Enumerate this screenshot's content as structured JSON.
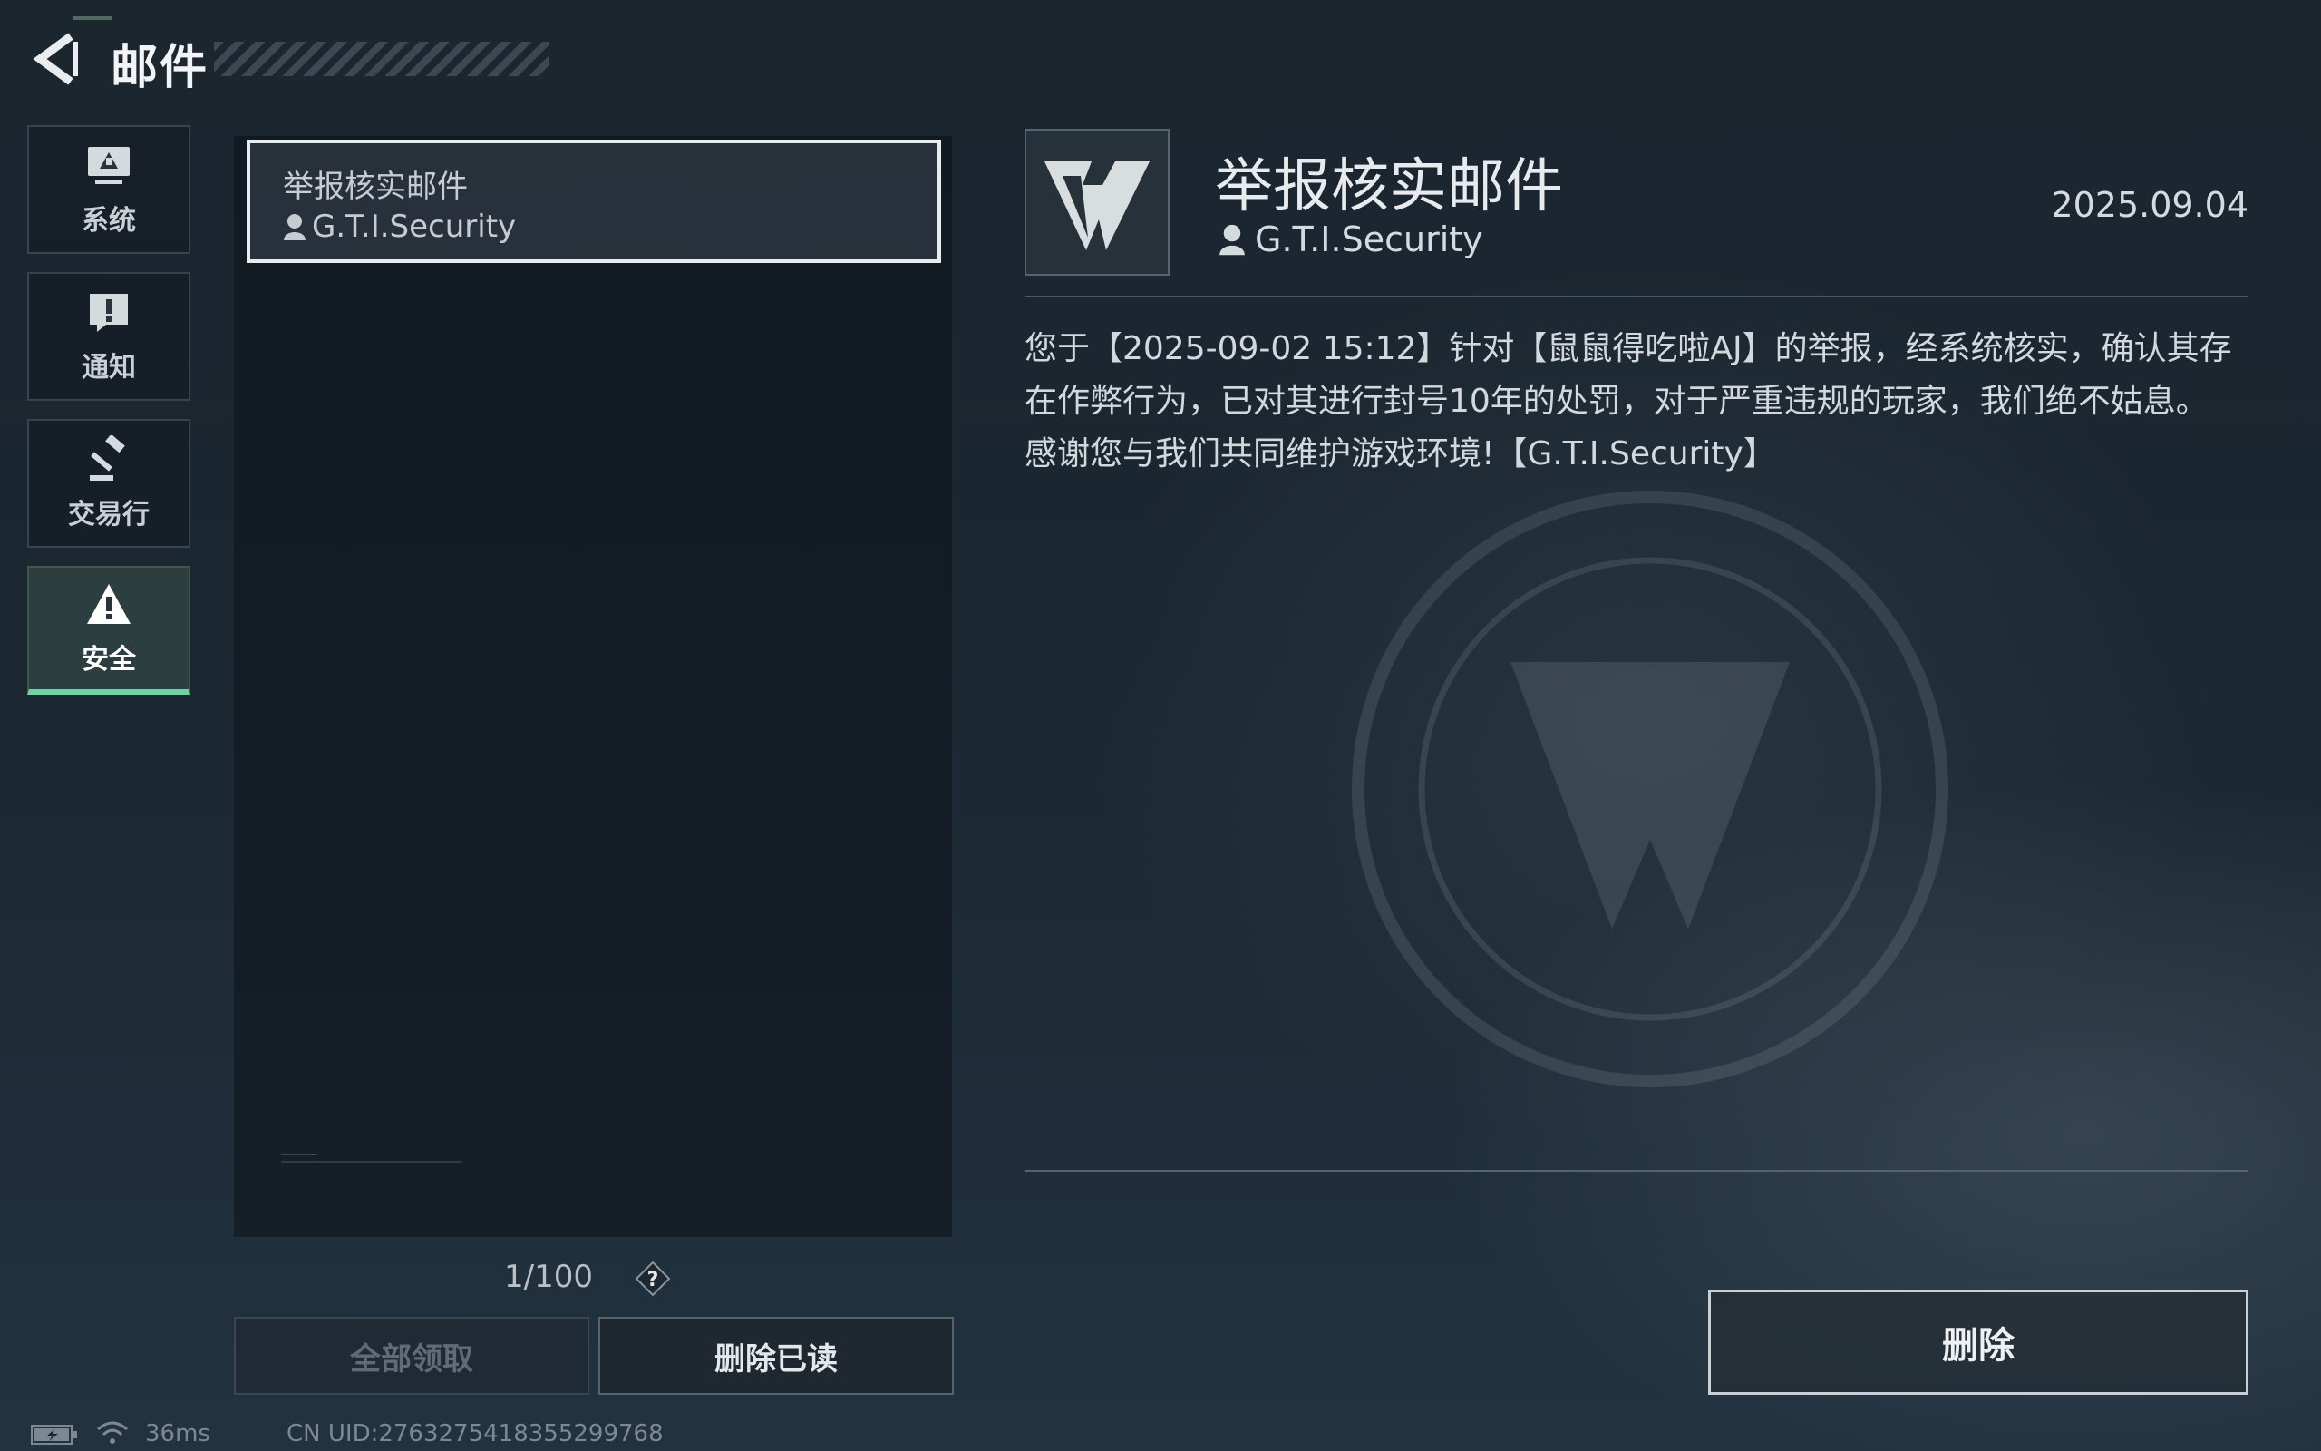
{
  "header": {
    "title": "邮件"
  },
  "sidebar": {
    "items": [
      {
        "label": "系统",
        "icon": "monitor-icon",
        "active": false
      },
      {
        "label": "通知",
        "icon": "exclamation-icon",
        "active": false
      },
      {
        "label": "交易行",
        "icon": "gavel-icon",
        "active": false
      },
      {
        "label": "安全",
        "icon": "warning-icon",
        "active": true
      }
    ]
  },
  "mail_list": {
    "items": [
      {
        "subject": "举报核实邮件",
        "sender": "G.T.I.Security"
      }
    ],
    "counter": "1/100",
    "help_label": "?",
    "claim_all_label": "全部领取",
    "delete_read_label": "删除已读"
  },
  "detail": {
    "title": "举报核实邮件",
    "sender": "G.T.I.Security",
    "date": "2025.09.04",
    "body": "您于【2025-09-02 15:12】针对【鼠鼠得吃啦AJ】的举报，经系统核实，确认其存在作弊行为，已对其进行封号10年的处罚，对于严重违规的玩家，我们绝不姑息。感谢您与我们共同维护游戏环境!【G.T.I.Security】",
    "delete_label": "删除"
  },
  "status_bar": {
    "ping": "36ms",
    "uid": "CN UID:2763275418355299768"
  },
  "colors": {
    "accent": "#6fd2a0",
    "background": "#1c262f",
    "text": "#d9dee2"
  }
}
